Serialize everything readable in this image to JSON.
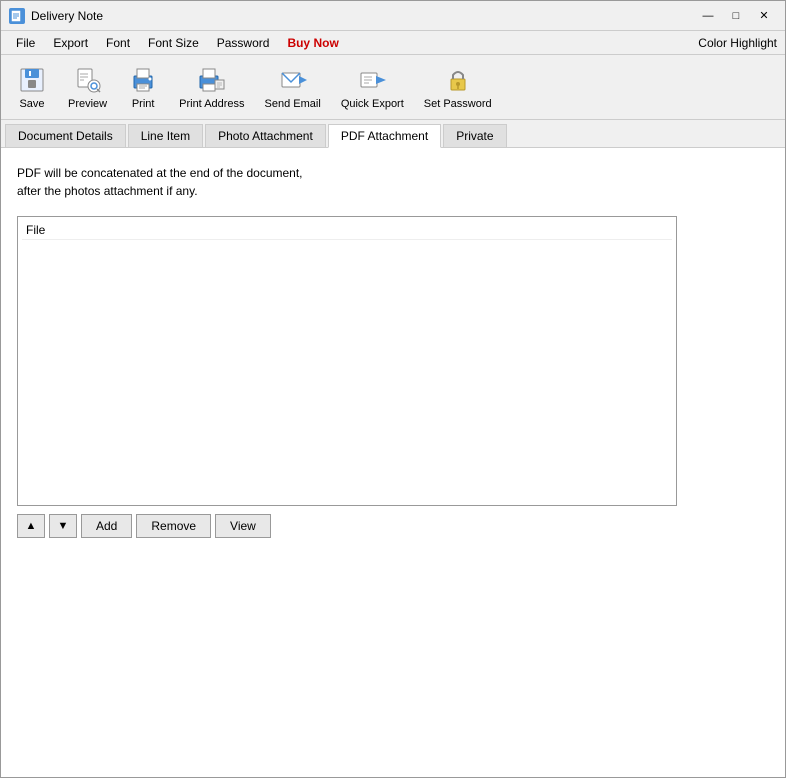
{
  "titlebar": {
    "icon": "DN",
    "title": "Delivery Note",
    "min_btn": "—",
    "max_btn": "□",
    "close_btn": "✕"
  },
  "menubar": {
    "items": [
      "File",
      "Export",
      "Font",
      "Font Size",
      "Password",
      "Buy Now"
    ],
    "buy_now_index": 5,
    "right_label": "Color Highlight"
  },
  "toolbar": {
    "buttons": [
      {
        "id": "save",
        "label": "Save"
      },
      {
        "id": "preview",
        "label": "Preview"
      },
      {
        "id": "print",
        "label": "Print"
      },
      {
        "id": "print-address",
        "label": "Print Address"
      },
      {
        "id": "send-email",
        "label": "Send Email"
      },
      {
        "id": "quick-export",
        "label": "Quick Export"
      },
      {
        "id": "set-password",
        "label": "Set Password"
      }
    ]
  },
  "tabs": {
    "items": [
      {
        "id": "document-details",
        "label": "Document Details"
      },
      {
        "id": "line-item",
        "label": "Line Item"
      },
      {
        "id": "photo-attachment",
        "label": "Photo Attachment"
      },
      {
        "id": "pdf-attachment",
        "label": "PDF Attachment"
      },
      {
        "id": "private",
        "label": "Private"
      }
    ],
    "active": "pdf-attachment"
  },
  "pdf_tab": {
    "description_line1": "PDF will be concatenated at the end of the document,",
    "description_line2": "after the photos attachment if any.",
    "file_column_header": "File",
    "buttons": {
      "up": "▲",
      "down": "▼",
      "add": "Add",
      "remove": "Remove",
      "view": "View"
    }
  }
}
